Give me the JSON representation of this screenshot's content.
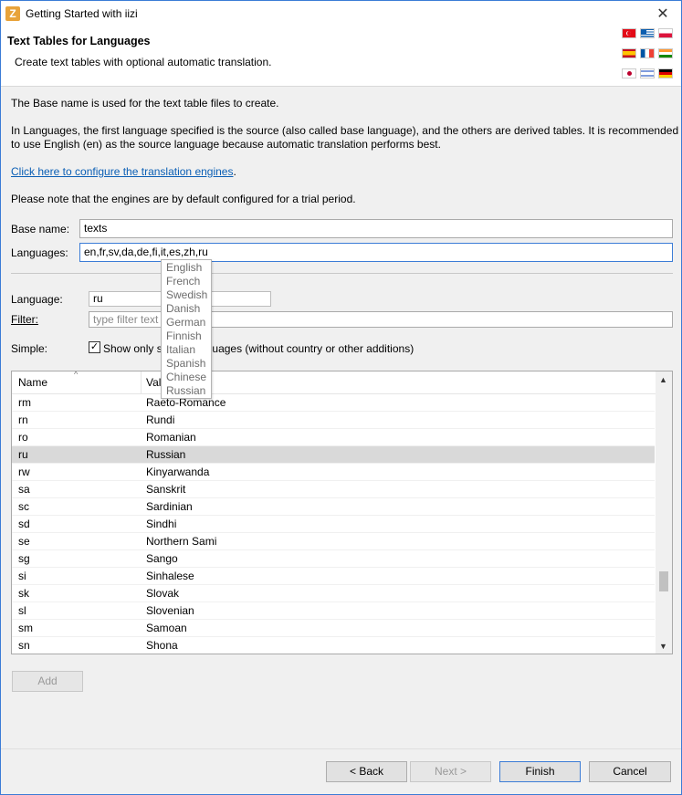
{
  "window": {
    "title": "Getting Started with iizi",
    "app_icon_letter": "Z",
    "close_glyph": "✕"
  },
  "banner": {
    "title": "Text Tables for Languages",
    "subtitle": "Create text tables with optional automatic translation.",
    "flags": [
      "turkey-flag",
      "greece-flag",
      "poland-flag",
      "spain-flag",
      "france-flag",
      "india-flag",
      "japan-flag",
      "israel-flag",
      "germany-flag"
    ]
  },
  "intro": {
    "p1": "The Base name is used for the text table files to create.",
    "p2": "In Languages, the first language specified is the source (also called base language), and the others are derived tables. It is recommended",
    "p3": "to use English (en) as the source language because automatic translation performs best.",
    "link": "Click here to configure the translation engines",
    "link_suffix": ".",
    "note": "Please note that the engines are by default configured for a trial period."
  },
  "form": {
    "base_name_label": "Base name:",
    "base_name_value": "texts",
    "languages_label": "Languages:",
    "languages_value": "en,fr,sv,da,de,fi,it,es,zh,ru",
    "language_label": "Language:",
    "language_value": "ru",
    "filter_label": "Filter:",
    "filter_placeholder": "type filter text",
    "simple_label": "Simple:",
    "simple_checked": true,
    "simple_text": "Show only simple languages (without country or other additions)"
  },
  "autocomplete": {
    "items": [
      "English",
      "French",
      "Swedish",
      "Danish",
      "German",
      "Finnish",
      "Italian",
      "Spanish",
      "Chinese",
      "Russian"
    ]
  },
  "table": {
    "columns": [
      "Name",
      "Value"
    ],
    "selected_name": "ru",
    "rows": [
      {
        "name": "rm",
        "value": "Raeto-Romance"
      },
      {
        "name": "rn",
        "value": "Rundi"
      },
      {
        "name": "ro",
        "value": "Romanian"
      },
      {
        "name": "ru",
        "value": "Russian"
      },
      {
        "name": "rw",
        "value": "Kinyarwanda"
      },
      {
        "name": "sa",
        "value": "Sanskrit"
      },
      {
        "name": "sc",
        "value": "Sardinian"
      },
      {
        "name": "sd",
        "value": "Sindhi"
      },
      {
        "name": "se",
        "value": "Northern Sami"
      },
      {
        "name": "sg",
        "value": "Sango"
      },
      {
        "name": "si",
        "value": "Sinhalese"
      },
      {
        "name": "sk",
        "value": "Slovak"
      },
      {
        "name": "sl",
        "value": "Slovenian"
      },
      {
        "name": "sm",
        "value": "Samoan"
      },
      {
        "name": "sn",
        "value": "Shona"
      }
    ]
  },
  "buttons": {
    "add": "Add",
    "back": "< Back",
    "next": "Next >",
    "finish": "Finish",
    "cancel": "Cancel"
  }
}
